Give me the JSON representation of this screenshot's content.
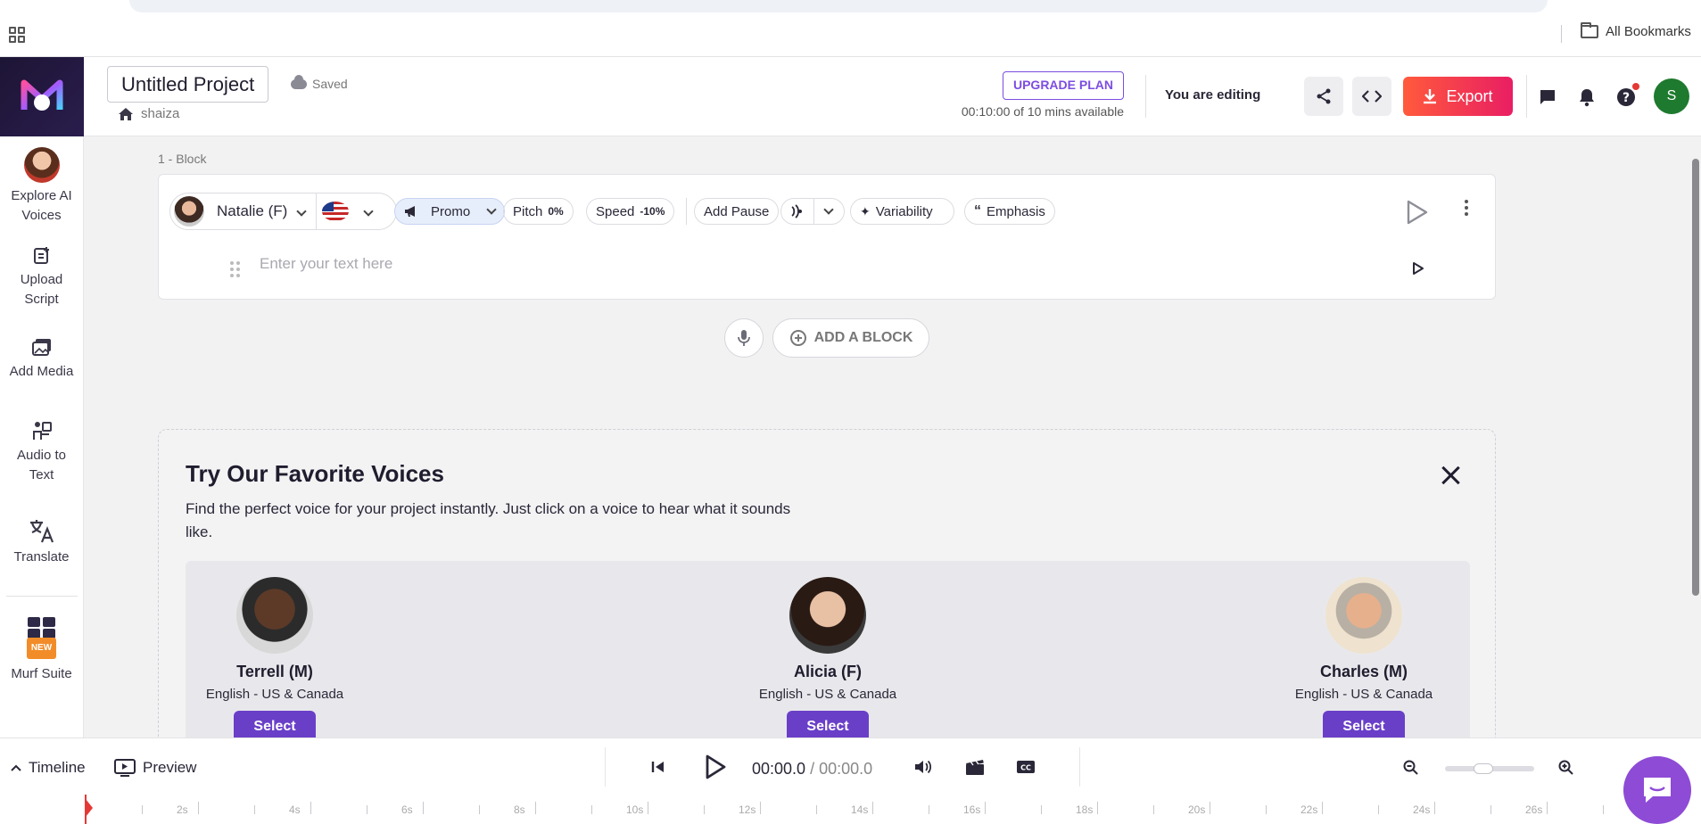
{
  "browser": {
    "bookmarks_label": "All Bookmarks"
  },
  "sidebar": {
    "items": [
      {
        "label": "Explore AI Voices",
        "icon": "voice-avatar-icon"
      },
      {
        "label": "Upload Script",
        "icon": "upload-script-icon"
      },
      {
        "label": "Add Media",
        "icon": "media-icon"
      },
      {
        "label": "Audio to Text",
        "icon": "audio-to-text-icon"
      },
      {
        "label": "Translate",
        "icon": "translate-icon"
      },
      {
        "label": "Murf Suite",
        "icon": "suite-icon",
        "badge": "NEW"
      }
    ]
  },
  "header": {
    "project_title": "Untitled Project",
    "saved_status": "Saved",
    "breadcrumb": "shaiza",
    "upgrade_label": "UPGRADE PLAN",
    "minutes_available": "00:10:00 of 10 mins available",
    "editing_status": "You are editing",
    "export_label": "Export",
    "user_initial": "S"
  },
  "block": {
    "label": "1 -  Block",
    "voice": "Natalie (F)",
    "style": "Promo",
    "pitch_label": "Pitch",
    "pitch_value": "0%",
    "speed_label": "Speed",
    "speed_value": "-10%",
    "add_pause": "Add Pause",
    "variability": "Variability",
    "emphasis": "Emphasis",
    "text_placeholder": "Enter your text here"
  },
  "add_block_label": "ADD A BLOCK",
  "favorites": {
    "title": "Try Our Favorite Voices",
    "description": "Find the perfect voice for your project instantly. Just click on a voice to hear what it sounds like.",
    "voices": [
      {
        "name": "Terrell (M)",
        "language": "English - US & Canada",
        "select": "Select"
      },
      {
        "name": "Alicia (F)",
        "language": "English - US & Canada",
        "select": "Select"
      },
      {
        "name": "Charles (M)",
        "language": "English - US & Canada",
        "select": "Select"
      }
    ]
  },
  "bottom": {
    "timeline_label": "Timeline",
    "preview_label": "Preview",
    "current_time": "00:00.0",
    "separator": " / ",
    "total_time": "00:00.0",
    "ruler_labels": [
      "2s",
      "4s",
      "6s",
      "8s",
      "10s",
      "12s",
      "14s",
      "16s",
      "18s",
      "20s",
      "22s",
      "24s",
      "26s"
    ]
  },
  "colors": {
    "accent": "#6a3fc8",
    "export_gradient_start": "#ff5a3c",
    "export_gradient_end": "#e91e63",
    "upgrade": "#7c4de0"
  }
}
